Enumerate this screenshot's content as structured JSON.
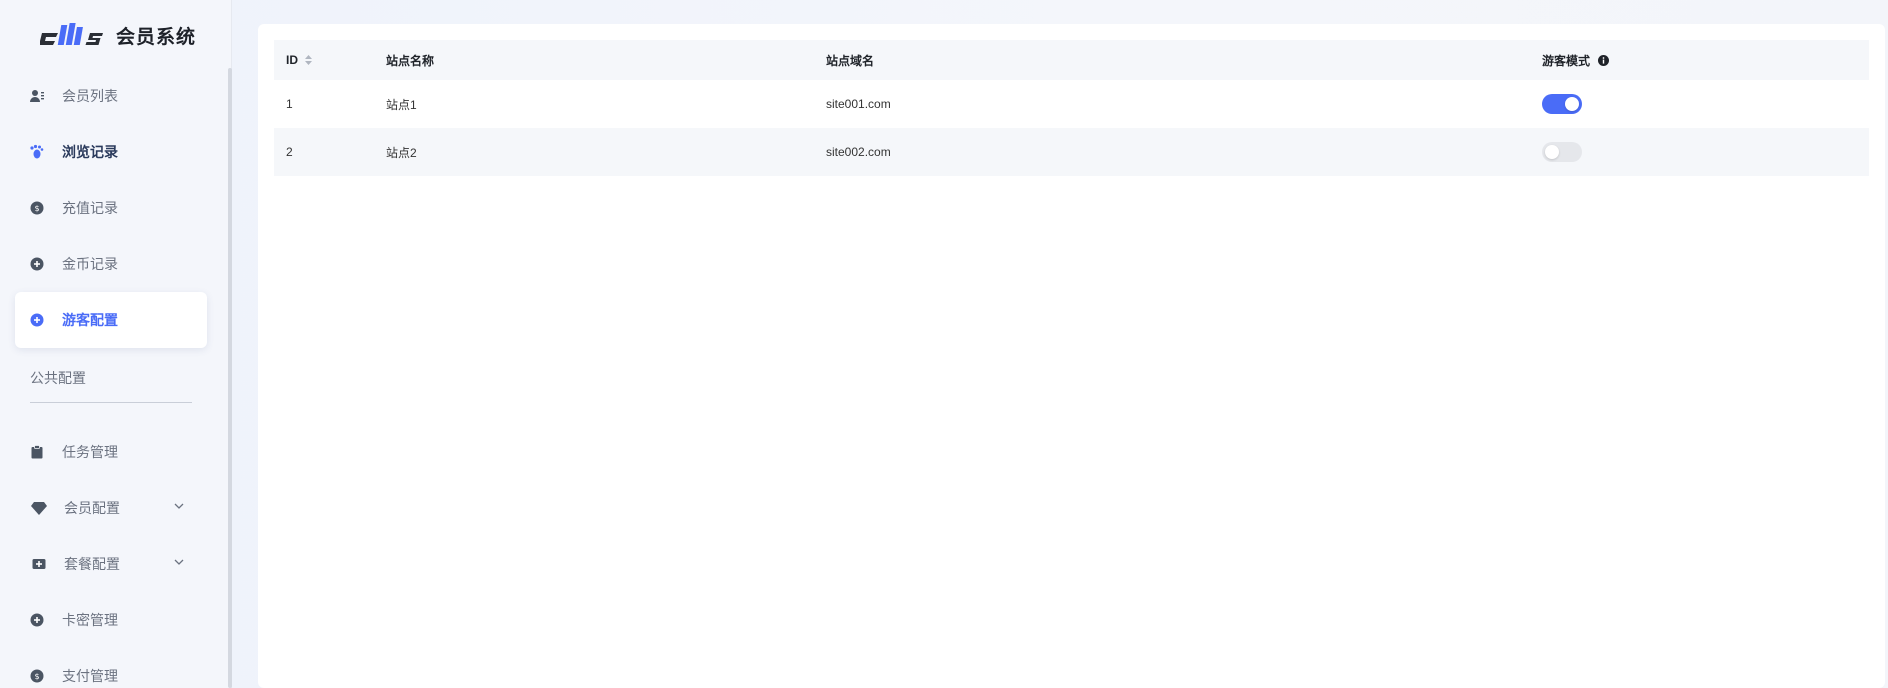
{
  "app": {
    "title": "会员系统",
    "accent": "#4a6cf7"
  },
  "sidebar": {
    "items": [
      {
        "label": "会员列表",
        "icon": "user-list-icon"
      },
      {
        "label": "浏览记录",
        "icon": "footprint-icon"
      },
      {
        "label": "充值记录",
        "icon": "coin-circle-icon"
      },
      {
        "label": "金币记录",
        "icon": "plus-circle-icon"
      },
      {
        "label": "游客配置",
        "icon": "plus-circle-icon"
      },
      {
        "label": "任务管理",
        "icon": "clipboard-icon"
      },
      {
        "label": "会员配置",
        "icon": "diamond-icon"
      },
      {
        "label": "套餐配置",
        "icon": "package-icon"
      },
      {
        "label": "卡密管理",
        "icon": "plus-circle-icon"
      },
      {
        "label": "支付管理",
        "icon": "coin-circle-icon"
      }
    ],
    "group_title": "公共配置"
  },
  "table": {
    "headers": {
      "id": "ID",
      "name": "站点名称",
      "domain": "站点域名",
      "guest": "游客模式"
    },
    "rows": [
      {
        "id": "1",
        "name": "站点1",
        "domain": "site001.com",
        "guest_mode": true
      },
      {
        "id": "2",
        "name": "站点2",
        "domain": "site002.com",
        "guest_mode": false
      }
    ]
  }
}
